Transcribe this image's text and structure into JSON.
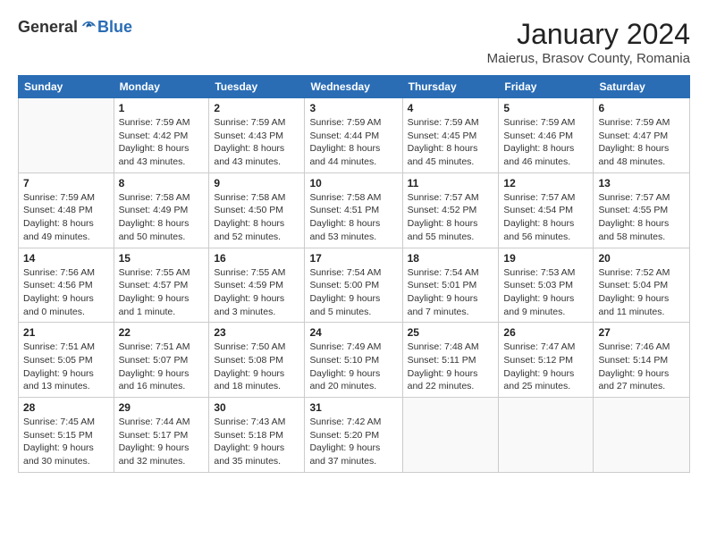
{
  "logo": {
    "general": "General",
    "blue": "Blue"
  },
  "title": {
    "month": "January 2024",
    "location": "Maierus, Brasov County, Romania"
  },
  "weekdays": [
    "Sunday",
    "Monday",
    "Tuesday",
    "Wednesday",
    "Thursday",
    "Friday",
    "Saturday"
  ],
  "weeks": [
    [
      {
        "day": "",
        "info": ""
      },
      {
        "day": "1",
        "info": "Sunrise: 7:59 AM\nSunset: 4:42 PM\nDaylight: 8 hours\nand 43 minutes."
      },
      {
        "day": "2",
        "info": "Sunrise: 7:59 AM\nSunset: 4:43 PM\nDaylight: 8 hours\nand 43 minutes."
      },
      {
        "day": "3",
        "info": "Sunrise: 7:59 AM\nSunset: 4:44 PM\nDaylight: 8 hours\nand 44 minutes."
      },
      {
        "day": "4",
        "info": "Sunrise: 7:59 AM\nSunset: 4:45 PM\nDaylight: 8 hours\nand 45 minutes."
      },
      {
        "day": "5",
        "info": "Sunrise: 7:59 AM\nSunset: 4:46 PM\nDaylight: 8 hours\nand 46 minutes."
      },
      {
        "day": "6",
        "info": "Sunrise: 7:59 AM\nSunset: 4:47 PM\nDaylight: 8 hours\nand 48 minutes."
      }
    ],
    [
      {
        "day": "7",
        "info": "Sunrise: 7:59 AM\nSunset: 4:48 PM\nDaylight: 8 hours\nand 49 minutes."
      },
      {
        "day": "8",
        "info": "Sunrise: 7:58 AM\nSunset: 4:49 PM\nDaylight: 8 hours\nand 50 minutes."
      },
      {
        "day": "9",
        "info": "Sunrise: 7:58 AM\nSunset: 4:50 PM\nDaylight: 8 hours\nand 52 minutes."
      },
      {
        "day": "10",
        "info": "Sunrise: 7:58 AM\nSunset: 4:51 PM\nDaylight: 8 hours\nand 53 minutes."
      },
      {
        "day": "11",
        "info": "Sunrise: 7:57 AM\nSunset: 4:52 PM\nDaylight: 8 hours\nand 55 minutes."
      },
      {
        "day": "12",
        "info": "Sunrise: 7:57 AM\nSunset: 4:54 PM\nDaylight: 8 hours\nand 56 minutes."
      },
      {
        "day": "13",
        "info": "Sunrise: 7:57 AM\nSunset: 4:55 PM\nDaylight: 8 hours\nand 58 minutes."
      }
    ],
    [
      {
        "day": "14",
        "info": "Sunrise: 7:56 AM\nSunset: 4:56 PM\nDaylight: 9 hours\nand 0 minutes."
      },
      {
        "day": "15",
        "info": "Sunrise: 7:55 AM\nSunset: 4:57 PM\nDaylight: 9 hours\nand 1 minute."
      },
      {
        "day": "16",
        "info": "Sunrise: 7:55 AM\nSunset: 4:59 PM\nDaylight: 9 hours\nand 3 minutes."
      },
      {
        "day": "17",
        "info": "Sunrise: 7:54 AM\nSunset: 5:00 PM\nDaylight: 9 hours\nand 5 minutes."
      },
      {
        "day": "18",
        "info": "Sunrise: 7:54 AM\nSunset: 5:01 PM\nDaylight: 9 hours\nand 7 minutes."
      },
      {
        "day": "19",
        "info": "Sunrise: 7:53 AM\nSunset: 5:03 PM\nDaylight: 9 hours\nand 9 minutes."
      },
      {
        "day": "20",
        "info": "Sunrise: 7:52 AM\nSunset: 5:04 PM\nDaylight: 9 hours\nand 11 minutes."
      }
    ],
    [
      {
        "day": "21",
        "info": "Sunrise: 7:51 AM\nSunset: 5:05 PM\nDaylight: 9 hours\nand 13 minutes."
      },
      {
        "day": "22",
        "info": "Sunrise: 7:51 AM\nSunset: 5:07 PM\nDaylight: 9 hours\nand 16 minutes."
      },
      {
        "day": "23",
        "info": "Sunrise: 7:50 AM\nSunset: 5:08 PM\nDaylight: 9 hours\nand 18 minutes."
      },
      {
        "day": "24",
        "info": "Sunrise: 7:49 AM\nSunset: 5:10 PM\nDaylight: 9 hours\nand 20 minutes."
      },
      {
        "day": "25",
        "info": "Sunrise: 7:48 AM\nSunset: 5:11 PM\nDaylight: 9 hours\nand 22 minutes."
      },
      {
        "day": "26",
        "info": "Sunrise: 7:47 AM\nSunset: 5:12 PM\nDaylight: 9 hours\nand 25 minutes."
      },
      {
        "day": "27",
        "info": "Sunrise: 7:46 AM\nSunset: 5:14 PM\nDaylight: 9 hours\nand 27 minutes."
      }
    ],
    [
      {
        "day": "28",
        "info": "Sunrise: 7:45 AM\nSunset: 5:15 PM\nDaylight: 9 hours\nand 30 minutes."
      },
      {
        "day": "29",
        "info": "Sunrise: 7:44 AM\nSunset: 5:17 PM\nDaylight: 9 hours\nand 32 minutes."
      },
      {
        "day": "30",
        "info": "Sunrise: 7:43 AM\nSunset: 5:18 PM\nDaylight: 9 hours\nand 35 minutes."
      },
      {
        "day": "31",
        "info": "Sunrise: 7:42 AM\nSunset: 5:20 PM\nDaylight: 9 hours\nand 37 minutes."
      },
      {
        "day": "",
        "info": ""
      },
      {
        "day": "",
        "info": ""
      },
      {
        "day": "",
        "info": ""
      }
    ]
  ]
}
